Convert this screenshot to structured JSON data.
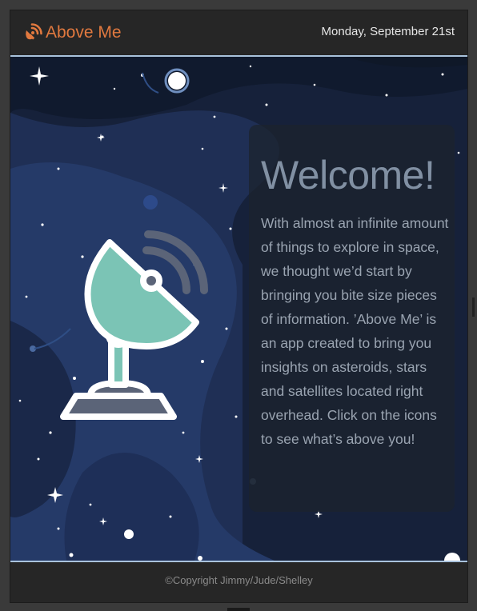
{
  "header": {
    "brand_label": "Above Me",
    "brand_icon": "satellite-signal-icon",
    "date": "Monday, September 21st"
  },
  "hero": {
    "illustration": "satellite-dish-icon",
    "welcome_title": "Welcome!",
    "intro_text": "With almost an infinite amount of things to explore in space, we thought we’d start by bringing you bite size pieces of information. ’Above Me’ is an app created to bring you insights on asteroids, stars and satellites located right overhead. Click on the icons to see what’s above you!"
  },
  "footer": {
    "copyright": "©Copyright Jimmy/Jude/Shelley"
  },
  "colors": {
    "accent": "#e1793f",
    "header_bg": "#262626",
    "space_bg": "#16213a",
    "divider": "#a9c2dc",
    "dish": "#7bc4b5"
  }
}
